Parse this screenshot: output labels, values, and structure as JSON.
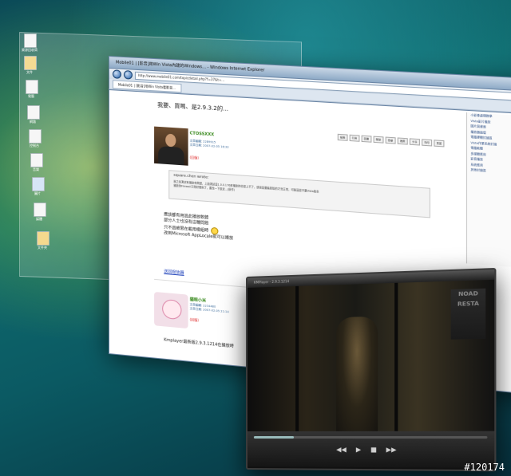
{
  "ie": {
    "title": "Mobile01 | [影音]用Win Vista內建的Windows... - Windows Internet Explorer",
    "address": "http://www.mobile01.com/topicdetail.php?f=37&t=...",
    "tab_label": "Mobile01 | [影音]用Win Vista看影音..."
  },
  "thread": {
    "title": "我要、買嗎、是2.9.3.2的..."
  },
  "sidebar": {
    "items": [
      "小影像處理教學",
      "Vista影片播放",
      "圖片與畫面",
      "播放器論壇",
      "電腦硬體討論區",
      "Vista作業系統討論",
      "電腦軟體",
      "多媒體應用",
      "影音播放",
      "系統應用",
      "其他討論區"
    ]
  },
  "post_actions": [
    "編輯",
    "引用",
    "回覆",
    "刪除",
    "檢舉",
    "推薦",
    "分享",
    "列印",
    "頁首"
  ],
  "post1": {
    "user": "CTOSSXXX",
    "meta": [
      "文章編輯: 2289915",
      "文章日期: 2007-02-05 16:32"
    ],
    "badge": "(回復)",
    "quote_header": "square.chen wrote:",
    "quote_lines": [
      "我之前測試有播放有問題，上面測試是1.0.0.176來播放的也是上不了，感覺是要裝新版的才會正常，可能還是不要Vista版本",
      "播放的Firewall又剛好限制了，要改一下設定...(原作)"
    ],
    "body": [
      "應該都有用過此播放軟體",
      "部分人士也沒有這種問題",
      "",
      "只不過被限在載用模組時",
      "",
      "改到Microsoft AppLocale就可以播放"
    ],
    "link": "送回撥放器"
  },
  "post2": {
    "user": "貓眼小米",
    "meta": [
      "文章編輯: 2234480",
      "文章日期: 2007-02-05 21:14"
    ],
    "badge": "(回復)",
    "text": "Kmplayer最新版2.9.3.1214在播放時"
  },
  "player": {
    "title": "KMPlayer - 2.9.3.1214",
    "sign_text": "NOAD RESTA",
    "progress": 0.18
  },
  "desktop_icons": [
    "資源回收筒",
    "文件",
    "電腦",
    "網路",
    "控制台",
    "音樂",
    "圖片",
    "媒體",
    "文件夾"
  ],
  "watermark": "#120174"
}
